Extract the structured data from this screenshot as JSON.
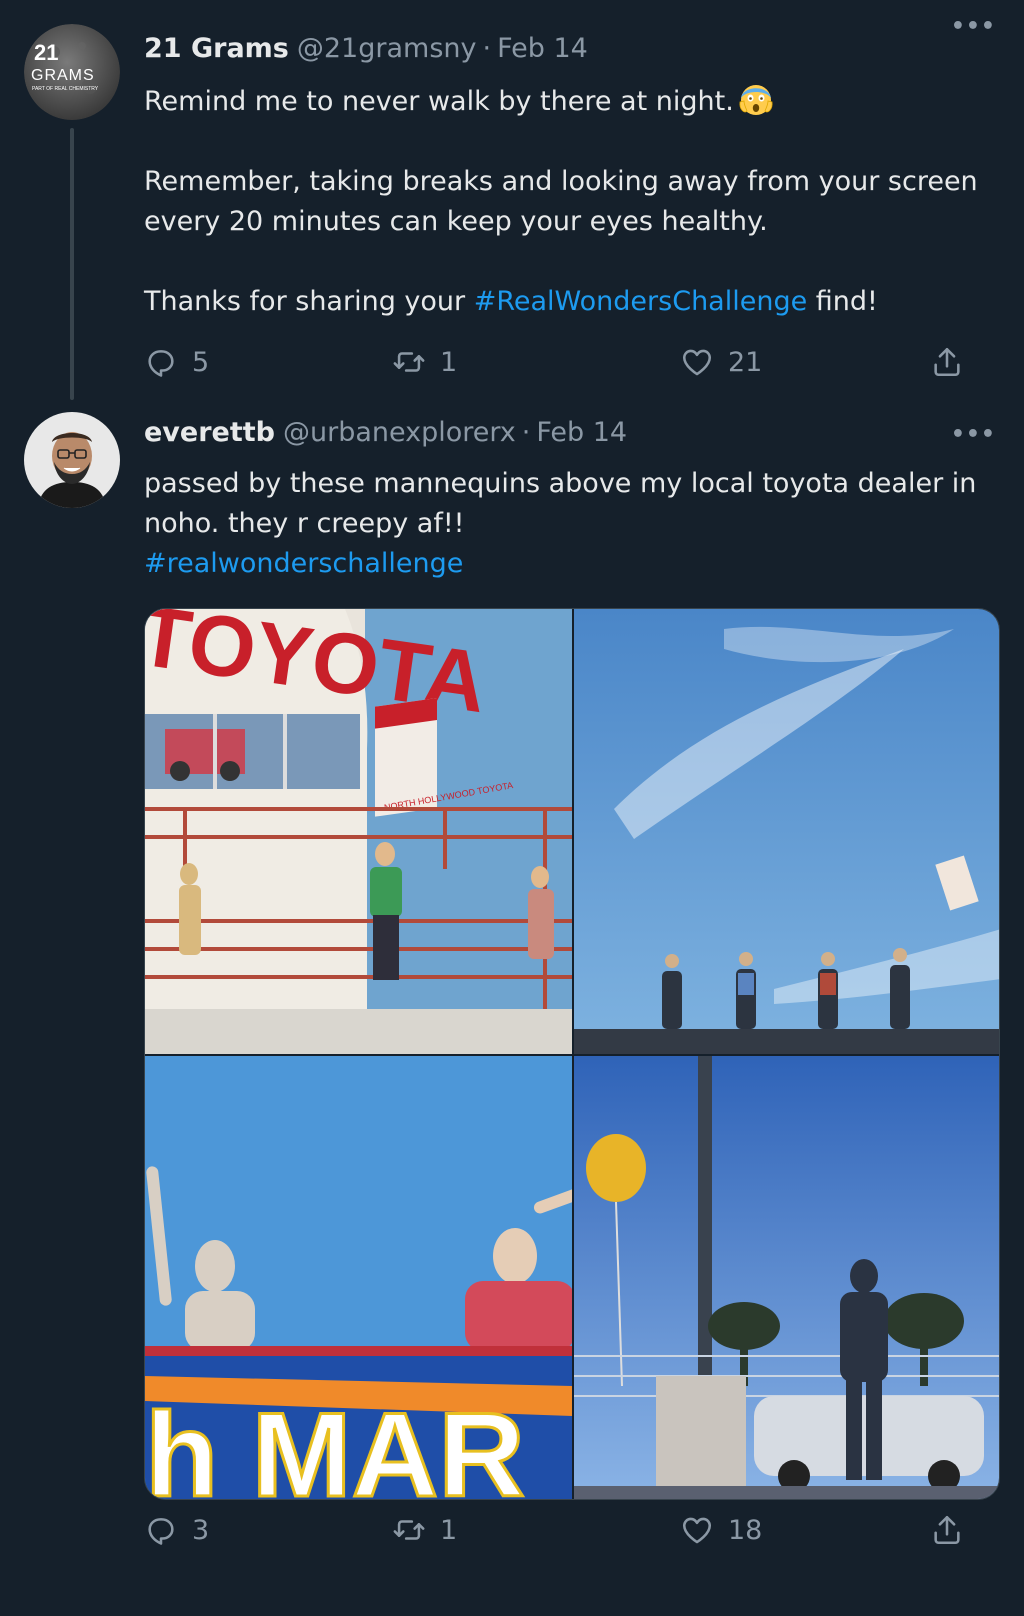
{
  "tweets": [
    {
      "author_name": "21 Grams",
      "handle": "@21gramsny",
      "separator": "·",
      "date": "Feb 14",
      "avatar": {
        "line1": "21",
        "line2": "GRAMS",
        "line3": "PART OF REAL CHEMISTRY"
      },
      "text_line1": "Remind me to never walk by there at night.",
      "emoji": "face-screaming-in-fear",
      "text_para2": "Remember, taking breaks and looking away from your screen every 20 minutes can keep your eyes healthy.",
      "text_para3_before": "Thanks for sharing your ",
      "hashtag": "#RealWondersChallenge",
      "text_para3_after": " find!",
      "more_label": "•••",
      "replies": "5",
      "retweets": "1",
      "likes": "21"
    },
    {
      "author_name": "everettb",
      "handle": "@urbanexplorerx",
      "separator": "·",
      "date": "Feb 14",
      "text_body": "passed by these mannequins above my local toyota dealer in noho. they r creepy af!!",
      "hashtag": "#realwonderschallenge",
      "more_label": "•••",
      "replies": "3",
      "retweets": "1",
      "likes": "18",
      "photo_texts": {
        "sign": "TOYOTA",
        "flag": "NORTH HOLLYWOOD TOYOTA",
        "banner": "h MAR"
      }
    }
  ],
  "colors": {
    "background": "#15202b",
    "text": "#e7e9ea",
    "muted": "#8b98a5",
    "link": "#1d9bf0",
    "border": "#38444d"
  },
  "icons": [
    "reply-icon",
    "retweet-icon",
    "like-icon",
    "share-icon",
    "more-icon"
  ]
}
